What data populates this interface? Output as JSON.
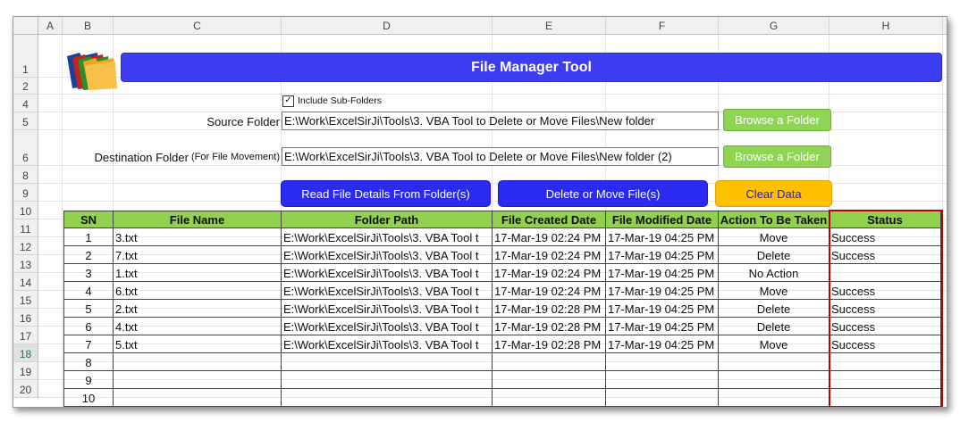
{
  "columns": [
    "A",
    "B",
    "C",
    "D",
    "E",
    "F",
    "G",
    "H"
  ],
  "rows": [
    "1",
    "2",
    "4",
    "5",
    "6",
    "8",
    "9",
    "10",
    "11",
    "12",
    "13",
    "14",
    "15",
    "16",
    "17",
    "18",
    "19",
    "20"
  ],
  "selected_row": "18",
  "title": "File Manager Tool",
  "include_subfolders": {
    "label": "Include Sub-Folders",
    "checked": "✓"
  },
  "source": {
    "label": "Source Folder",
    "path": "E:\\Work\\ExcelSirJi\\Tools\\3. VBA Tool to Delete or Move Files\\New folder",
    "button": "Browse a Folder"
  },
  "destination": {
    "label": "Destination Folder",
    "note": "(For File Movement)",
    "path": "E:\\Work\\ExcelSirJi\\Tools\\3. VBA Tool to Delete or Move Files\\New folder (2)",
    "button": "Browse a Folder"
  },
  "actions": {
    "read": "Read File Details From Folder(s)",
    "delete_move": "Delete or Move File(s)",
    "clear": "Clear Data"
  },
  "table": {
    "headers": [
      "SN",
      "File Name",
      "Folder Path",
      "File Created Date",
      "File Modified Date",
      "Action To Be Taken",
      "Status"
    ],
    "rows": [
      [
        "1",
        "3.txt",
        "E:\\Work\\ExcelSirJi\\Tools\\3. VBA Tool t",
        "17-Mar-19 02:24 PM",
        "17-Mar-19 04:25 PM",
        "Move",
        "Success"
      ],
      [
        "2",
        "7.txt",
        "E:\\Work\\ExcelSirJi\\Tools\\3. VBA Tool t",
        "17-Mar-19 02:24 PM",
        "17-Mar-19 04:25 PM",
        "Delete",
        "Success"
      ],
      [
        "3",
        "1.txt",
        "E:\\Work\\ExcelSirJi\\Tools\\3. VBA Tool t",
        "17-Mar-19 02:24 PM",
        "17-Mar-19 04:25 PM",
        "No Action",
        ""
      ],
      [
        "4",
        "6.txt",
        "E:\\Work\\ExcelSirJi\\Tools\\3. VBA Tool t",
        "17-Mar-19 02:24 PM",
        "17-Mar-19 04:25 PM",
        "Move",
        "Success"
      ],
      [
        "5",
        "2.txt",
        "E:\\Work\\ExcelSirJi\\Tools\\3. VBA Tool t",
        "17-Mar-19 02:28 PM",
        "17-Mar-19 04:25 PM",
        "Delete",
        "Success"
      ],
      [
        "6",
        "4.txt",
        "E:\\Work\\ExcelSirJi\\Tools\\3. VBA Tool t",
        "17-Mar-19 02:28 PM",
        "17-Mar-19 04:25 PM",
        "Delete",
        "Success"
      ],
      [
        "7",
        "5.txt",
        "E:\\Work\\ExcelSirJi\\Tools\\3. VBA Tool t",
        "17-Mar-19 02:28 PM",
        "17-Mar-19 04:25 PM",
        "Move",
        "Success"
      ],
      [
        "8",
        "",
        "",
        "",
        "",
        "",
        ""
      ],
      [
        "9",
        "",
        "",
        "",
        "",
        "",
        ""
      ],
      [
        "10",
        "",
        "",
        "",
        "",
        "",
        ""
      ]
    ]
  },
  "colors": {
    "title_bar": "#3c3cf0",
    "header_fill": "#92d050",
    "browse_button": "#8fd455",
    "action_button": "#2a2af0",
    "clear_button": "#ffc000",
    "status_border": "#c00000"
  }
}
